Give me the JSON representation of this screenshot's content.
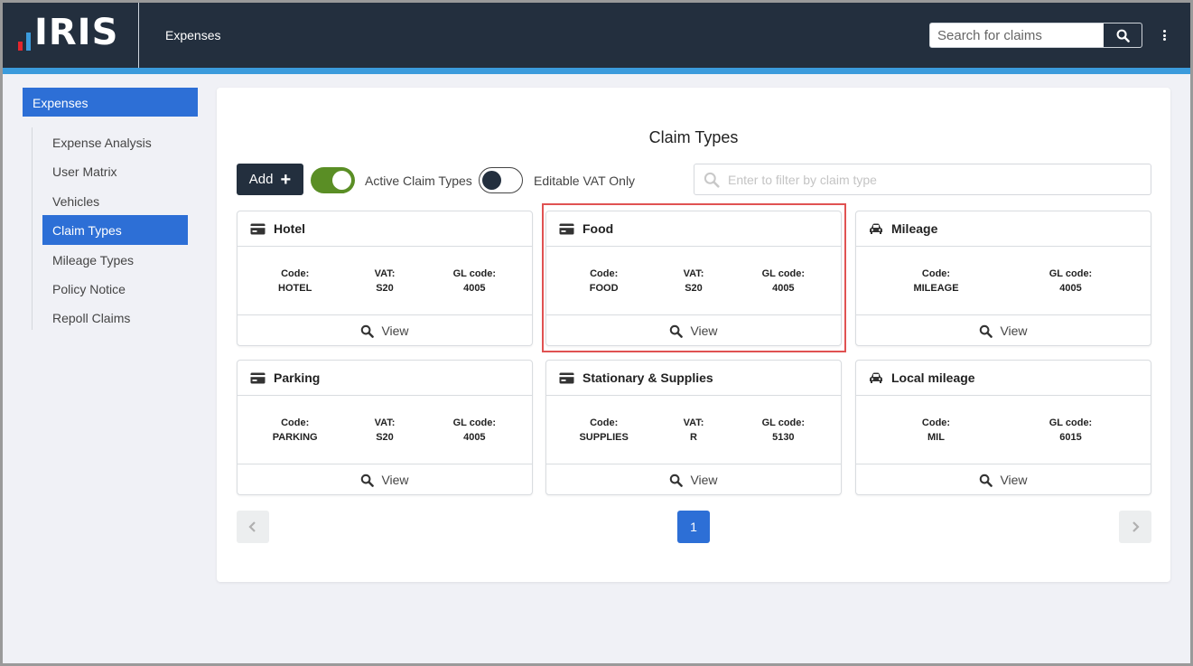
{
  "header": {
    "logo_text": "IRIS",
    "app_title": "Expenses",
    "search_placeholder": "Search for claims"
  },
  "sidebar": {
    "section_label": "Expenses",
    "items": [
      {
        "label": "Expense Analysis",
        "active": false
      },
      {
        "label": "User Matrix",
        "active": false
      },
      {
        "label": "Vehicles",
        "active": false
      },
      {
        "label": "Claim Types",
        "active": true
      },
      {
        "label": "Mileage Types",
        "active": false
      },
      {
        "label": "Policy Notice",
        "active": false
      },
      {
        "label": "Repoll Claims",
        "active": false
      }
    ]
  },
  "main": {
    "title": "Claim Types",
    "add_label": "Add",
    "toggles": {
      "active_claim_types": {
        "label": "Active Claim Types",
        "on": true
      },
      "editable_vat_only": {
        "label": "Editable VAT Only",
        "on": false
      }
    },
    "filter_placeholder": "Enter to filter by claim type",
    "cards": [
      {
        "name": "Hotel",
        "icon": "credit-card-icon",
        "fields": [
          {
            "label": "Code:",
            "value": "HOTEL"
          },
          {
            "label": "VAT:",
            "value": "S20"
          },
          {
            "label": "GL code:",
            "value": "4005"
          }
        ],
        "view_label": "View"
      },
      {
        "name": "Food",
        "icon": "credit-card-icon",
        "fields": [
          {
            "label": "Code:",
            "value": "FOOD"
          },
          {
            "label": "VAT:",
            "value": "S20"
          },
          {
            "label": "GL code:",
            "value": "4005"
          }
        ],
        "view_label": "View"
      },
      {
        "name": "Mileage",
        "icon": "car-icon",
        "fields": [
          {
            "label": "Code:",
            "value": "MILEAGE"
          },
          {
            "label": "GL code:",
            "value": "4005"
          }
        ],
        "view_label": "View"
      },
      {
        "name": "Parking",
        "icon": "credit-card-icon",
        "fields": [
          {
            "label": "Code:",
            "value": "PARKING"
          },
          {
            "label": "VAT:",
            "value": "S20"
          },
          {
            "label": "GL code:",
            "value": "4005"
          }
        ],
        "view_label": "View"
      },
      {
        "name": "Stationary & Supplies",
        "icon": "credit-card-icon",
        "fields": [
          {
            "label": "Code:",
            "value": "SUPPLIES"
          },
          {
            "label": "VAT:",
            "value": "R"
          },
          {
            "label": "GL code:",
            "value": "5130"
          }
        ],
        "view_label": "View"
      },
      {
        "name": "Local mileage",
        "icon": "car-icon",
        "fields": [
          {
            "label": "Code:",
            "value": "MIL"
          },
          {
            "label": "GL code:",
            "value": "6015"
          }
        ],
        "view_label": "View"
      }
    ],
    "pagination": {
      "current_page": "1"
    }
  },
  "colors": {
    "header_bg": "#232f3e",
    "accent_blue": "#2d6fd6",
    "header_stripe": "#3b9bdc",
    "toggle_on": "#5a8e25",
    "highlight_border": "#e05252"
  }
}
